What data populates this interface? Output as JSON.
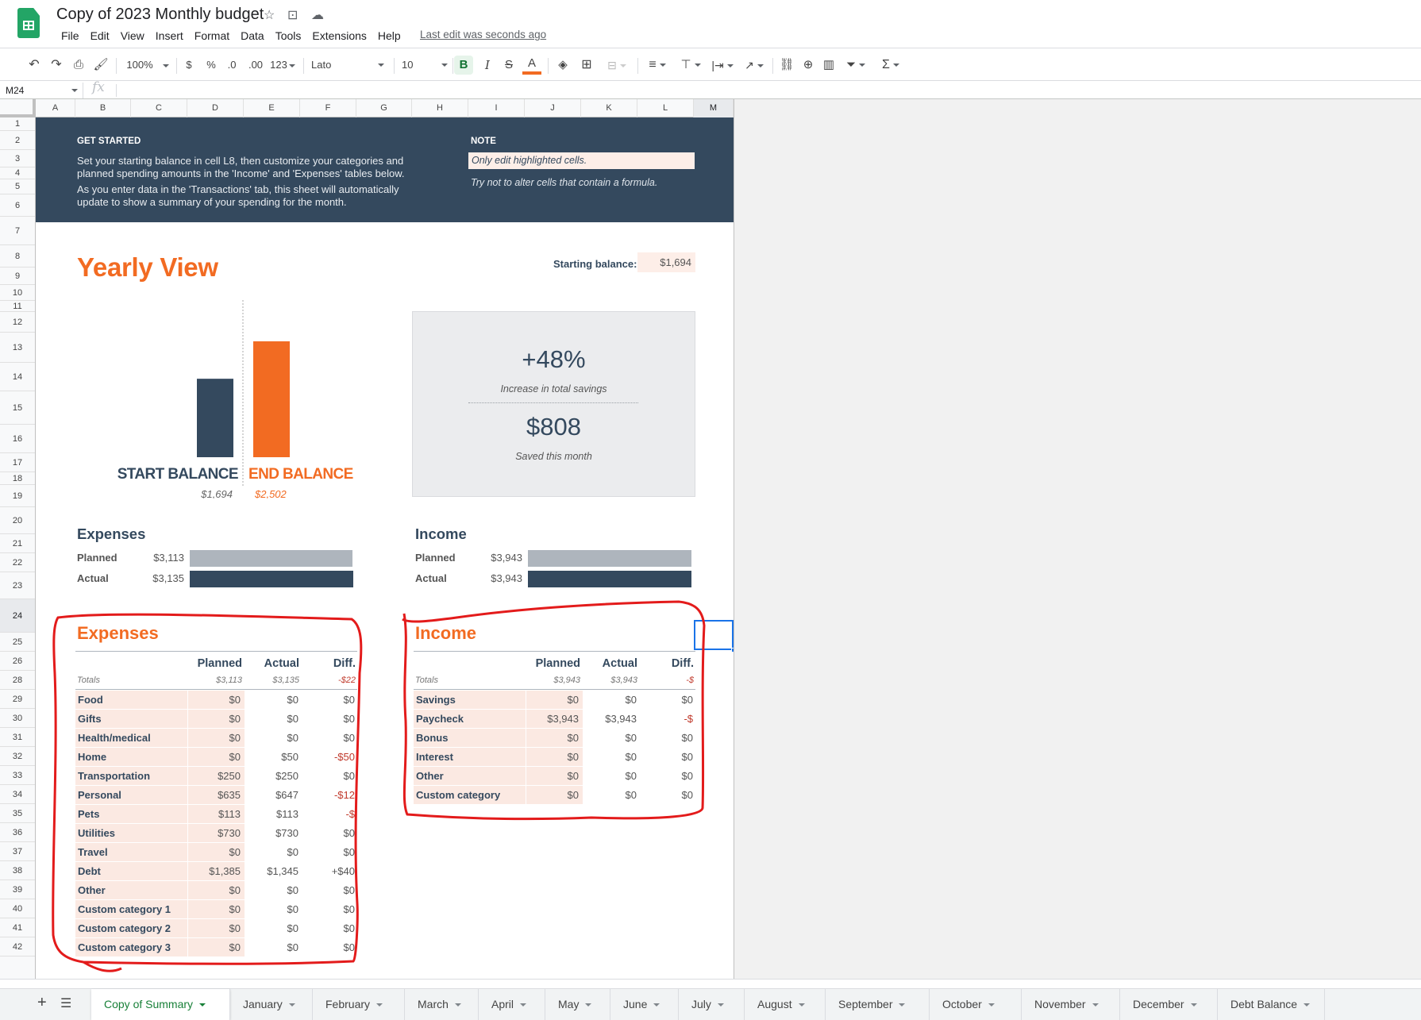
{
  "app": {
    "doc_title": "Copy of 2023 Monthly budget",
    "menu": [
      "File",
      "Edit",
      "View",
      "Insert",
      "Format",
      "Data",
      "Tools",
      "Extensions",
      "Help"
    ],
    "last_edit": "Last edit was seconds ago"
  },
  "toolbar": {
    "zoom": "100%",
    "currency": "$",
    "percent": "%",
    "dec_decrease": ".0",
    "dec_increase": ".00",
    "more_formats": "123",
    "font": "Lato",
    "font_size": "10",
    "bold": "B",
    "italic": "I",
    "strike": "S",
    "text_color": "A",
    "text_color_hex": "#f26b22"
  },
  "formula_bar": {
    "cell_ref": "M24",
    "fx": "fx",
    "value": ""
  },
  "grid": {
    "columns": [
      "A",
      "B",
      "C",
      "D",
      "E",
      "F",
      "G",
      "H",
      "I",
      "J",
      "K",
      "L",
      "M"
    ],
    "selected_column": "M",
    "rows": [
      "1",
      "2",
      "3",
      "4",
      "5",
      "6",
      "7",
      "8",
      "9",
      "10",
      "11",
      "12",
      "13",
      "14",
      "15",
      "16",
      "17",
      "18",
      "19",
      "20",
      "21",
      "22",
      "23",
      "24",
      "25",
      "26",
      "28",
      "29",
      "30",
      "31",
      "32",
      "33",
      "34",
      "35",
      "36",
      "37",
      "38",
      "39",
      "40",
      "41",
      "42"
    ],
    "selected_row": "24",
    "selected_cell": "M24"
  },
  "banner": {
    "get_started_heading": "GET STARTED",
    "get_started_line1": "Set your starting balance in cell L8, then customize your categories and",
    "get_started_line2": "planned spending amounts in the 'Income' and 'Expenses' tables below.",
    "get_started_line3": "As you enter data in the 'Transactions' tab, this sheet will automatically",
    "get_started_line4": "update to show a summary of your spending for the month.",
    "note_heading": "NOTE",
    "note_line1": "Only edit highlighted cells.",
    "note_line2": "Try not to alter cells that contain a formula."
  },
  "yearly": {
    "title": "Yearly View",
    "starting_balance_label": "Starting balance:",
    "starting_balance_value": "$1,694"
  },
  "chart_data": {
    "type": "bar",
    "categories": [
      "START BALANCE",
      "END BALANCE"
    ],
    "values": [
      1694,
      2502
    ],
    "value_labels": [
      "$1,694",
      "$2,502"
    ],
    "colors": [
      "#34495e",
      "#f26b22"
    ],
    "ylim": [
      0,
      2502
    ]
  },
  "savings_card": {
    "pct_value": "+48%",
    "pct_label": "Increase in total savings",
    "saved_value": "$808",
    "saved_label": "Saved this month"
  },
  "expenses_summary": {
    "title": "Expenses",
    "planned_label": "Planned",
    "planned_value": "$3,113",
    "planned_amount": 3113,
    "actual_label": "Actual",
    "actual_value": "$3,135",
    "actual_amount": 3135
  },
  "income_summary": {
    "title": "Income",
    "planned_label": "Planned",
    "planned_value": "$3,943",
    "planned_amount": 3943,
    "actual_label": "Actual",
    "actual_value": "$3,943",
    "actual_amount": 3943
  },
  "expenses_table": {
    "title": "Expenses",
    "headers": [
      "Planned",
      "Actual",
      "Diff."
    ],
    "totals_label": "Totals",
    "totals": [
      "$3,113",
      "$3,135",
      "-$22"
    ],
    "rows": [
      {
        "name": "Food",
        "planned": "$0",
        "actual": "$0",
        "diff": "$0",
        "neg": false
      },
      {
        "name": "Gifts",
        "planned": "$0",
        "actual": "$0",
        "diff": "$0",
        "neg": false
      },
      {
        "name": "Health/medical",
        "planned": "$0",
        "actual": "$0",
        "diff": "$0",
        "neg": false
      },
      {
        "name": "Home",
        "planned": "$0",
        "actual": "$50",
        "diff": "-$50",
        "neg": true
      },
      {
        "name": "Transportation",
        "planned": "$250",
        "actual": "$250",
        "diff": "$0",
        "neg": false
      },
      {
        "name": "Personal",
        "planned": "$635",
        "actual": "$647",
        "diff": "-$12",
        "neg": true
      },
      {
        "name": "Pets",
        "planned": "$113",
        "actual": "$113",
        "diff": "-$",
        "neg": true
      },
      {
        "name": "Utilities",
        "planned": "$730",
        "actual": "$730",
        "diff": "$0",
        "neg": false
      },
      {
        "name": "Travel",
        "planned": "$0",
        "actual": "$0",
        "diff": "$0",
        "neg": false
      },
      {
        "name": "Debt",
        "planned": "$1,385",
        "actual": "$1,345",
        "diff": "+$40",
        "neg": false
      },
      {
        "name": "Other",
        "planned": "$0",
        "actual": "$0",
        "diff": "$0",
        "neg": false
      },
      {
        "name": "Custom category 1",
        "planned": "$0",
        "actual": "$0",
        "diff": "$0",
        "neg": false
      },
      {
        "name": "Custom category 2",
        "planned": "$0",
        "actual": "$0",
        "diff": "$0",
        "neg": false
      },
      {
        "name": "Custom category 3",
        "planned": "$0",
        "actual": "$0",
        "diff": "$0",
        "neg": false
      }
    ]
  },
  "income_table": {
    "title": "Income",
    "headers": [
      "Planned",
      "Actual",
      "Diff."
    ],
    "totals_label": "Totals",
    "totals": [
      "$3,943",
      "$3,943",
      "-$"
    ],
    "totals_neg": [
      false,
      false,
      true
    ],
    "rows": [
      {
        "name": "Savings",
        "planned": "$0",
        "actual": "$0",
        "diff": "$0",
        "neg": false
      },
      {
        "name": "Paycheck",
        "planned": "$3,943",
        "actual": "$3,943",
        "diff": "-$",
        "neg": true
      },
      {
        "name": "Bonus",
        "planned": "$0",
        "actual": "$0",
        "diff": "$0",
        "neg": false
      },
      {
        "name": "Interest",
        "planned": "$0",
        "actual": "$0",
        "diff": "$0",
        "neg": false
      },
      {
        "name": "Other",
        "planned": "$0",
        "actual": "$0",
        "diff": "$0",
        "neg": false
      },
      {
        "name": "Custom category",
        "planned": "$0",
        "actual": "$0",
        "diff": "$0",
        "neg": false
      }
    ]
  },
  "sheet_tabs": {
    "active": "Copy of Summary",
    "tabs": [
      "Copy of Summary",
      "January",
      "February",
      "March",
      "April",
      "May",
      "June",
      "July",
      "August",
      "September",
      "October",
      "November",
      "December",
      "Debt Balance"
    ]
  },
  "colors": {
    "navy": "#34495e",
    "orange": "#f26b22",
    "highlight_cell": "#fbe9e2",
    "negative": "#c0392b",
    "annotation_red": "#e31b1b",
    "selection_blue": "#1a73e8"
  }
}
